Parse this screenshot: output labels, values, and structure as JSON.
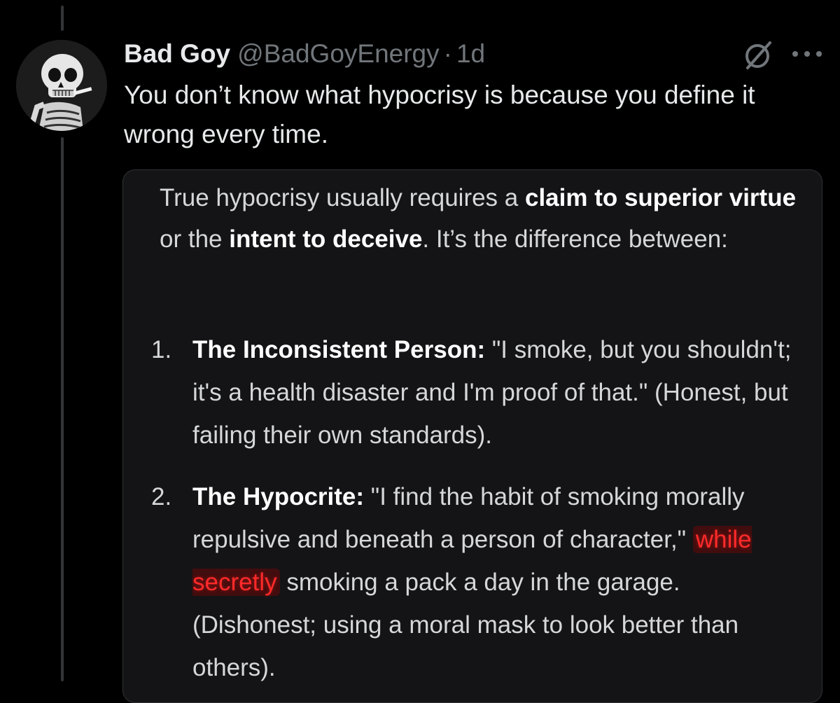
{
  "tweet": {
    "display_name": "Bad Goy",
    "handle": "@BadGoyEnergy",
    "separator": "·",
    "time": "1d",
    "text": "You don’t know what hypocrisy is because you define it wrong every time.",
    "avatar_icon": "skull-smoking-avatar",
    "grok_icon": "grok-icon",
    "more_icon": "more-options-icon"
  },
  "media": {
    "intro": {
      "t1": "True hypocrisy usually requires a ",
      "b1": "claim to superior virtue",
      "t2": " or the ",
      "b2": "intent to deceive",
      "t3": ". It’s the difference between:"
    },
    "items": [
      {
        "number": "1.",
        "title": "The Inconsistent Person:",
        "text": " \"I smoke, but you shouldn't; it's a health disaster and I'm proof of that.\" (Honest, but failing their own standards)."
      },
      {
        "number": "2.",
        "title": "The Hypocrite:",
        "text_before": " \"I find the habit of smoking morally repulsive and beneath a person of character,\" ",
        "highlight": "while secretly",
        "text_after": " smoking a pack a day in the garage. (Dishonest; using a moral mask to look better than others)."
      }
    ]
  },
  "colors": {
    "background": "#000000",
    "text_primary": "#e7e9ea",
    "text_secondary": "#71767b",
    "card_background": "#141416",
    "highlight": "#ff2a2a"
  }
}
